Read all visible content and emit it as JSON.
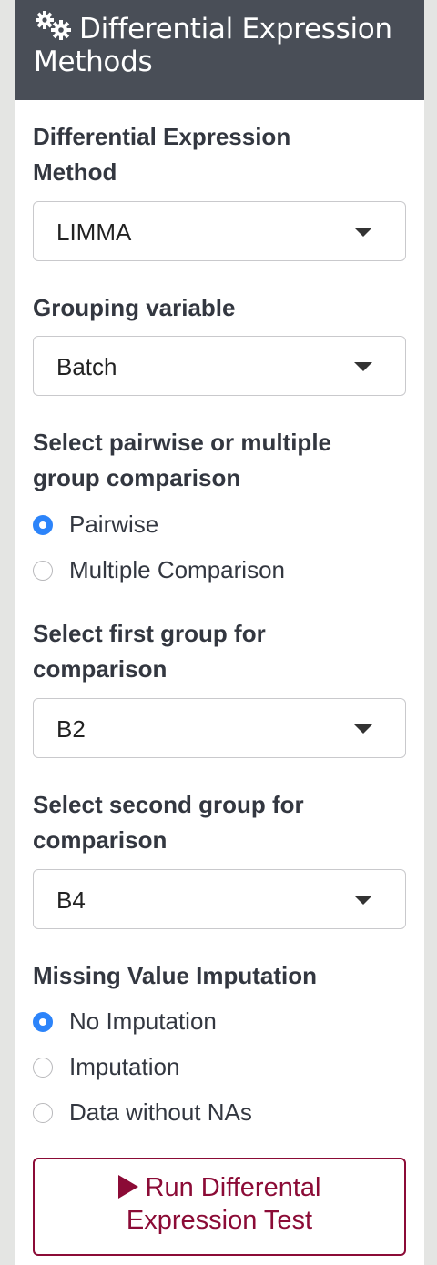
{
  "header": {
    "title_line1": "Differential Expression",
    "title_line2": "Methods",
    "icon": "gears-icon"
  },
  "de_method": {
    "label_line1": "Differential Expression",
    "label_line2": "Method",
    "selected": "LIMMA"
  },
  "grouping": {
    "label": "Grouping variable",
    "selected": "Batch"
  },
  "comparison_type": {
    "label_line1": "Select pairwise or multiple",
    "label_line2": "group comparison",
    "options": [
      {
        "label": "Pairwise",
        "checked": true
      },
      {
        "label": "Multiple Comparison",
        "checked": false
      }
    ]
  },
  "first_group": {
    "label_line1": "Select first group for",
    "label_line2": "comparison",
    "selected": "B2"
  },
  "second_group": {
    "label_line1": "Select second group for",
    "label_line2": "comparison",
    "selected": "B4"
  },
  "imputation": {
    "label": "Missing Value Imputation",
    "options": [
      {
        "label": "No Imputation",
        "checked": true
      },
      {
        "label": "Imputation",
        "checked": false
      },
      {
        "label": "Data without NAs",
        "checked": false
      }
    ]
  },
  "run_button": {
    "label_line1": "Run Differental",
    "label_line2": "Expression Test",
    "icon": "play-icon"
  },
  "colors": {
    "header_bg": "#494e57",
    "accent_blue": "#2c84fa",
    "button_red": "#8b0b36"
  }
}
